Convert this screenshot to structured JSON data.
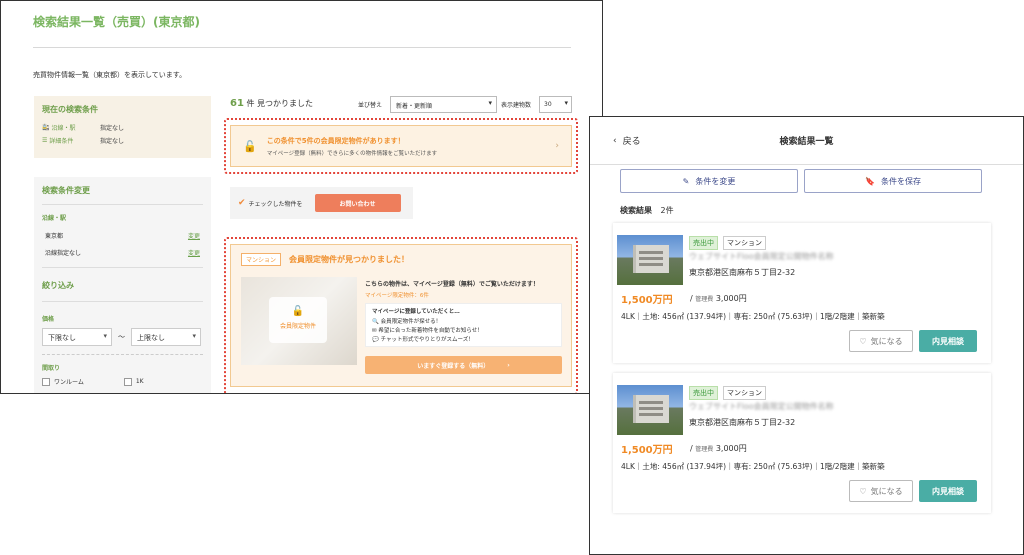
{
  "pc": {
    "title": "検索結果一覧（売買）(東京都)",
    "description": "売買物件情報一覧（東京都）を表示しています。",
    "current_conditions": {
      "title": "現在の検索条件",
      "rows": [
        {
          "label": "沿線・駅",
          "value": "指定なし"
        },
        {
          "label": "詳細条件",
          "value": "指定なし"
        }
      ]
    },
    "change_conditions": {
      "title": "検索条件変更",
      "subtitle": "沿線・駅",
      "rows": [
        {
          "label": "東京都",
          "link": "変更"
        },
        {
          "label": "沿線指定なし",
          "link": "変更"
        }
      ],
      "filter_title": "絞り込み",
      "price_label": "価格",
      "price_min": "下限なし",
      "price_sep": "〜",
      "price_max": "上限なし",
      "layout_label": "間取り",
      "layout_options": [
        "ワンルーム",
        "1K"
      ]
    },
    "count_number": "61",
    "count_suffix": "件 見つかりました",
    "sort_label": "並び替え",
    "sort_value": "新着・更新順",
    "per_page_label": "表示建物数",
    "per_page_value": "30",
    "banner": {
      "title": "この条件で5件の会員限定物件があります！",
      "subtitle": "マイページ登録（無料）できらに多くの物件情報をご覧いただけます"
    },
    "inquiry": {
      "label": "チェックした物件を",
      "button": "お問い合わせ"
    },
    "member": {
      "tag": "マンション",
      "title": "会員限定物件が見つかりました！",
      "image_label": "会員限定物件",
      "text1": "こちらの物件は、マイページ登録（無料）でご覧いただけます！",
      "text2": "マイページ限定物件：6件",
      "list_head": "マイページに登録していただくと…",
      "list": [
        "会員限定物件が探せる！",
        "希望に合った新着物件を自動でお知らせ！",
        "チャット形式でやりとりがスムーズ！"
      ],
      "register_button": "いますぐ登録する（無料）"
    }
  },
  "sp": {
    "back": "戻る",
    "title": "検索結果一覧",
    "change_button": "条件を変更",
    "save_button": "条件を保存",
    "results_label": "検索結果",
    "results_count": "2件",
    "cards": [
      {
        "status": "売出中",
        "type": "マンション",
        "name_blurred": "ウェブサイトFloo会員限定公開物件名称",
        "address": "東京都港区南麻布５丁目2-32",
        "price": "1,500万円",
        "fee_label": "管理費",
        "fee": "3,000円",
        "spec": "4LK｜土地: 456㎡ (137.94坪)｜専有: 250㎡ (75.63坪)｜1階/2階建｜築新築",
        "fav": "気になる",
        "visit": "内見相談"
      },
      {
        "status": "売出中",
        "type": "マンション",
        "name_blurred": "ウェブサイトFloo会員限定公開物件名称",
        "address": "東京都港区南麻布５丁目2-32",
        "price": "1,500万円",
        "fee_label": "管理費",
        "fee": "3,000円",
        "spec": "4LK｜土地: 456㎡ (137.94坪)｜専有: 250㎡ (75.63坪)｜1階/2階建｜築新築",
        "fav": "気になる",
        "visit": "内見相談"
      }
    ]
  },
  "colors": {
    "accent_green": "#7bb661",
    "accent_orange": "#f0902e",
    "highlight_red": "#e2453a",
    "teal_button": "#4aada5"
  }
}
